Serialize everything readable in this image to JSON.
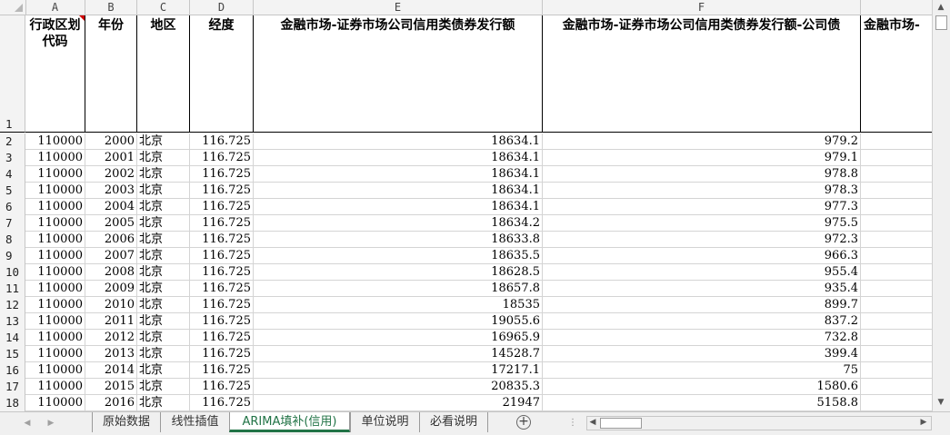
{
  "columns": [
    "A",
    "B",
    "C",
    "D",
    "E",
    "F"
  ],
  "header_row_number": "1",
  "headers": {
    "a": "行政区划代码",
    "b": "年份",
    "c": "地区",
    "d": "经度",
    "e": "金融市场-证券市场公司信用类债券发行额",
    "f": "金融市场-证券市场公司信用类债券发行额-公司债",
    "g": "金融市场-"
  },
  "rows": [
    {
      "num": "2",
      "a": "110000",
      "b": "2000",
      "c": "北京",
      "d": "116.725",
      "e": "18634.1",
      "f": "979.2"
    },
    {
      "num": "3",
      "a": "110000",
      "b": "2001",
      "c": "北京",
      "d": "116.725",
      "e": "18634.1",
      "f": "979.1"
    },
    {
      "num": "4",
      "a": "110000",
      "b": "2002",
      "c": "北京",
      "d": "116.725",
      "e": "18634.1",
      "f": "978.8"
    },
    {
      "num": "5",
      "a": "110000",
      "b": "2003",
      "c": "北京",
      "d": "116.725",
      "e": "18634.1",
      "f": "978.3"
    },
    {
      "num": "6",
      "a": "110000",
      "b": "2004",
      "c": "北京",
      "d": "116.725",
      "e": "18634.1",
      "f": "977.3"
    },
    {
      "num": "7",
      "a": "110000",
      "b": "2005",
      "c": "北京",
      "d": "116.725",
      "e": "18634.2",
      "f": "975.5"
    },
    {
      "num": "8",
      "a": "110000",
      "b": "2006",
      "c": "北京",
      "d": "116.725",
      "e": "18633.8",
      "f": "972.3"
    },
    {
      "num": "9",
      "a": "110000",
      "b": "2007",
      "c": "北京",
      "d": "116.725",
      "e": "18635.5",
      "f": "966.3"
    },
    {
      "num": "10",
      "a": "110000",
      "b": "2008",
      "c": "北京",
      "d": "116.725",
      "e": "18628.5",
      "f": "955.4"
    },
    {
      "num": "11",
      "a": "110000",
      "b": "2009",
      "c": "北京",
      "d": "116.725",
      "e": "18657.8",
      "f": "935.4"
    },
    {
      "num": "12",
      "a": "110000",
      "b": "2010",
      "c": "北京",
      "d": "116.725",
      "e": "18535",
      "f": "899.7"
    },
    {
      "num": "13",
      "a": "110000",
      "b": "2011",
      "c": "北京",
      "d": "116.725",
      "e": "19055.6",
      "f": "837.2"
    },
    {
      "num": "14",
      "a": "110000",
      "b": "2012",
      "c": "北京",
      "d": "116.725",
      "e": "16965.9",
      "f": "732.8"
    },
    {
      "num": "15",
      "a": "110000",
      "b": "2013",
      "c": "北京",
      "d": "116.725",
      "e": "14528.7",
      "f": "399.4"
    },
    {
      "num": "16",
      "a": "110000",
      "b": "2014",
      "c": "北京",
      "d": "116.725",
      "e": "17217.1",
      "f": "75"
    },
    {
      "num": "17",
      "a": "110000",
      "b": "2015",
      "c": "北京",
      "d": "116.725",
      "e": "20835.3",
      "f": "1580.6"
    },
    {
      "num": "18",
      "a": "110000",
      "b": "2016",
      "c": "北京",
      "d": "116.725",
      "e": "21947",
      "f": "5158.8"
    }
  ],
  "sheet_tabs": [
    "原始数据",
    "线性插值",
    "ARIMA填补(信用)",
    "单位说明",
    "必看说明"
  ],
  "active_tab": "ARIMA填补(信用)",
  "icons": {
    "scroll_up": "▲",
    "scroll_down": "▼",
    "scroll_left": "◀",
    "scroll_right": "▶",
    "add_sheet": "+",
    "tab_prev": "◀",
    "tab_next": "▶",
    "options": "⋮"
  },
  "colors": {
    "accent": "#217346",
    "comment_marker": "#d00000"
  }
}
